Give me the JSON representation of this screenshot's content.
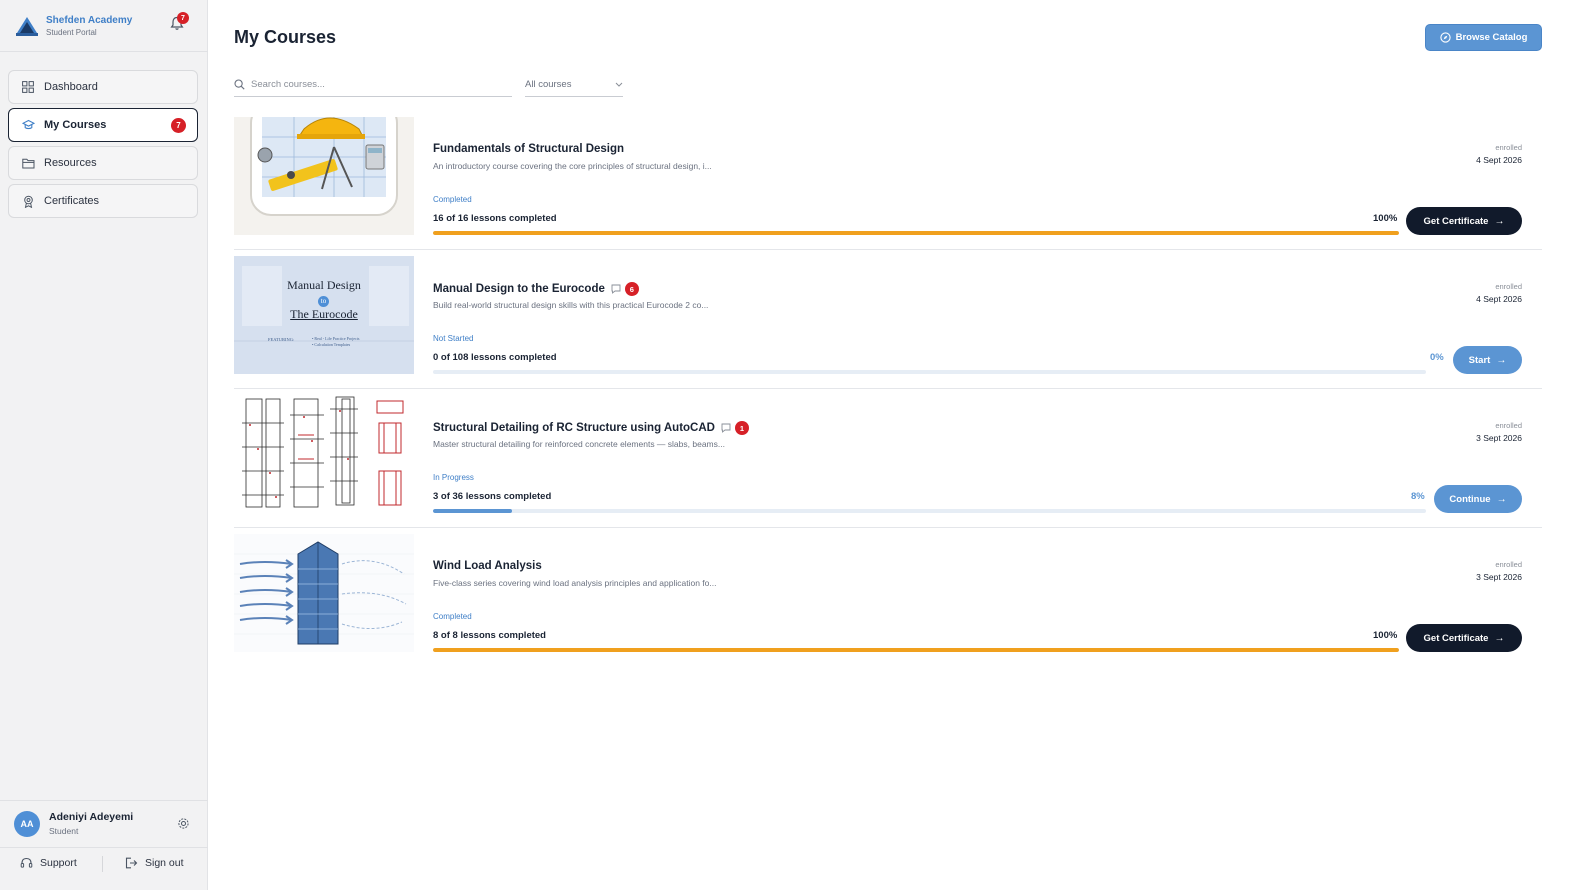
{
  "brand": {
    "name": "Shefden Academy",
    "subtitle": "Student Portal",
    "notification_count": "7"
  },
  "nav": [
    {
      "label": "Dashboard",
      "icon": "grid-icon"
    },
    {
      "label": "My Courses",
      "icon": "graduation-cap-icon",
      "badge": "7",
      "active": true
    },
    {
      "label": "Resources",
      "icon": "folder-icon"
    },
    {
      "label": "Certificates",
      "icon": "award-icon"
    }
  ],
  "user": {
    "initials": "AA",
    "name": "Adeniyi Adeyemi",
    "role": "Student"
  },
  "footer": {
    "support": "Support",
    "signout": "Sign out"
  },
  "page": {
    "title": "My Courses",
    "browse_label": "Browse Catalog"
  },
  "search": {
    "placeholder": "Search courses..."
  },
  "filter": {
    "selected": "All courses"
  },
  "colors": {
    "accent": "#5b95d3",
    "dark": "#111a2b",
    "orange": "#f0a01e",
    "badge": "#d62027"
  },
  "courses": [
    {
      "title": "Fundamentals of Structural Design",
      "description": "An introductory course covering the core principles of structural design, i...",
      "status": "Completed",
      "lessons": "16 of 16 lessons completed",
      "percent_label": "100%",
      "progress": 1.0,
      "enrolled_label": "enrolled",
      "date": "4 Sept 2026",
      "button": "Get Certificate",
      "messages": ""
    },
    {
      "title": "Manual Design to the Eurocode",
      "description": "Build real-world structural design skills with this practical Eurocode 2 co...",
      "status": "Not Started",
      "lessons": "0 of 108 lessons completed",
      "percent_label": "0%",
      "progress": 0.0,
      "enrolled_label": "enrolled",
      "date": "4 Sept 2026",
      "button": "Start",
      "messages": "6",
      "thumb_text": {
        "line1": "Manual Design",
        "line2": "to",
        "line3": "The Eurocode",
        "line4": "FEATURING:",
        "bullet1": "• Real - Life Practice Projects",
        "bullet2": "• Calculation Templates"
      }
    },
    {
      "title": "Structural Detailing of RC Structure using AutoCAD",
      "description": "Master structural detailing for reinforced concrete elements — slabs, beams...",
      "status": "In Progress",
      "lessons": "3 of 36 lessons completed",
      "percent_label": "8%",
      "progress": 0.08,
      "enrolled_label": "enrolled",
      "date": "3 Sept 2026",
      "button": "Continue",
      "messages": "1"
    },
    {
      "title": "Wind Load Analysis",
      "description": "Five-class series covering wind load analysis principles and application fo...",
      "status": "Completed",
      "lessons": "8 of 8 lessons completed",
      "percent_label": "100%",
      "progress": 1.0,
      "enrolled_label": "enrolled",
      "date": "3 Sept 2026",
      "button": "Get Certificate",
      "messages": ""
    }
  ]
}
